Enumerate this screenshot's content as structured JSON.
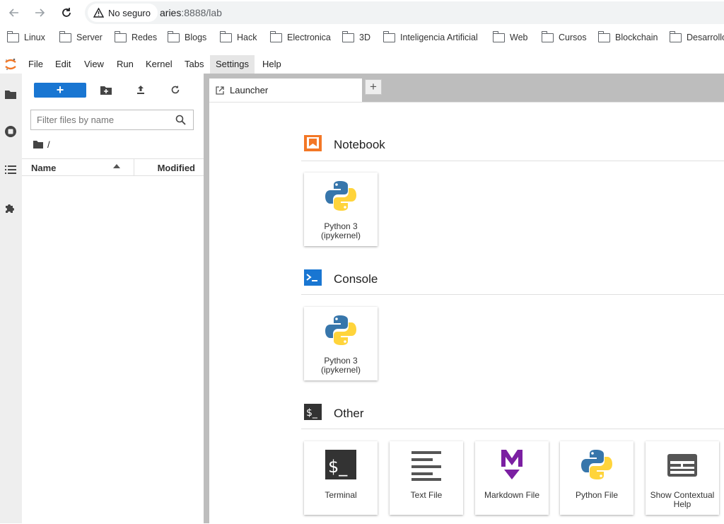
{
  "browser": {
    "security_label": "No seguro",
    "url_host": "aries",
    "url_rest": ":8888/lab",
    "bookmarks": [
      "Linux",
      "Server",
      "Redes",
      "Blogs",
      "Hack",
      "Electronica",
      "3D",
      "Inteligencia Artificial",
      "Web",
      "Cursos",
      "Blockchain",
      "Desarrollo"
    ]
  },
  "menubar": {
    "items": [
      "File",
      "Edit",
      "View",
      "Run",
      "Kernel",
      "Tabs",
      "Settings",
      "Help"
    ],
    "active": "Settings"
  },
  "filebrowser": {
    "new_label": "+",
    "filter_placeholder": "Filter files by name",
    "breadcrumb": "/",
    "columns": {
      "name": "Name",
      "modified": "Modified"
    }
  },
  "tabs": [
    {
      "label": "Launcher"
    }
  ],
  "add_tab_label": "+",
  "launcher": {
    "sections": [
      {
        "title": "Notebook",
        "cards": [
          {
            "label": "Python 3\n(ipykernel)",
            "icon": "python-icon"
          }
        ]
      },
      {
        "title": "Console",
        "cards": [
          {
            "label": "Python 3\n(ipykernel)",
            "icon": "python-icon"
          }
        ]
      },
      {
        "title": "Other",
        "cards": [
          {
            "label": "Terminal",
            "icon": "terminal-icon"
          },
          {
            "label": "Text File",
            "icon": "text-file-icon"
          },
          {
            "label": "Markdown File",
            "icon": "markdown-icon"
          },
          {
            "label": "Python File",
            "icon": "python-icon"
          },
          {
            "label": "Show Contextual Help",
            "icon": "contextual-help-icon"
          }
        ]
      }
    ]
  },
  "colors": {
    "accent": "#1976d2",
    "notebook_orange": "#f37726",
    "console_blue": "#0d47a1",
    "markdown_purple": "#7b1fa2"
  }
}
